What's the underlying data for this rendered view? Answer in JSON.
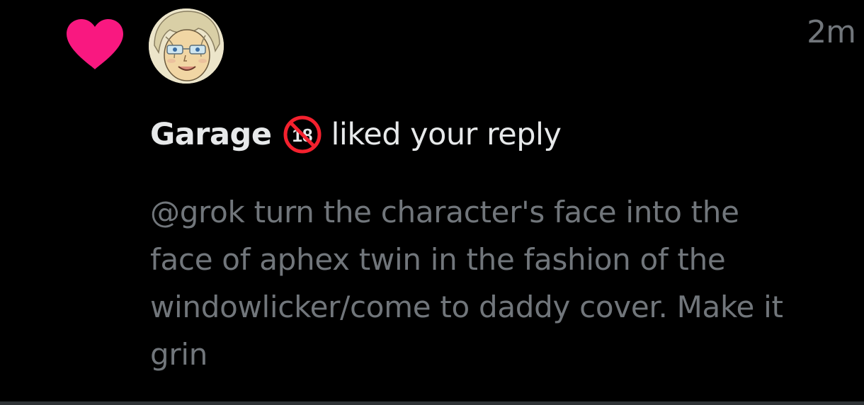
{
  "notification": {
    "type_icon": "heart-icon",
    "type_color": "#f91880",
    "avatar_icon": "avatar-icon",
    "timestamp": "2m",
    "user_name": "Garage",
    "badge_icon": "no-18-icon",
    "badge_number": "18",
    "action": "liked your reply",
    "reply_text": "@grok turn the character's face into the face of aphex twin in the fashion of the windowlicker/come to daddy cover. Make it grin"
  },
  "colors": {
    "background": "#000000",
    "primary_text": "#e7e9ea",
    "secondary_text": "#71767b",
    "heart": "#f91880",
    "badge_red": "#f4212e",
    "divider": "#2f3336"
  }
}
